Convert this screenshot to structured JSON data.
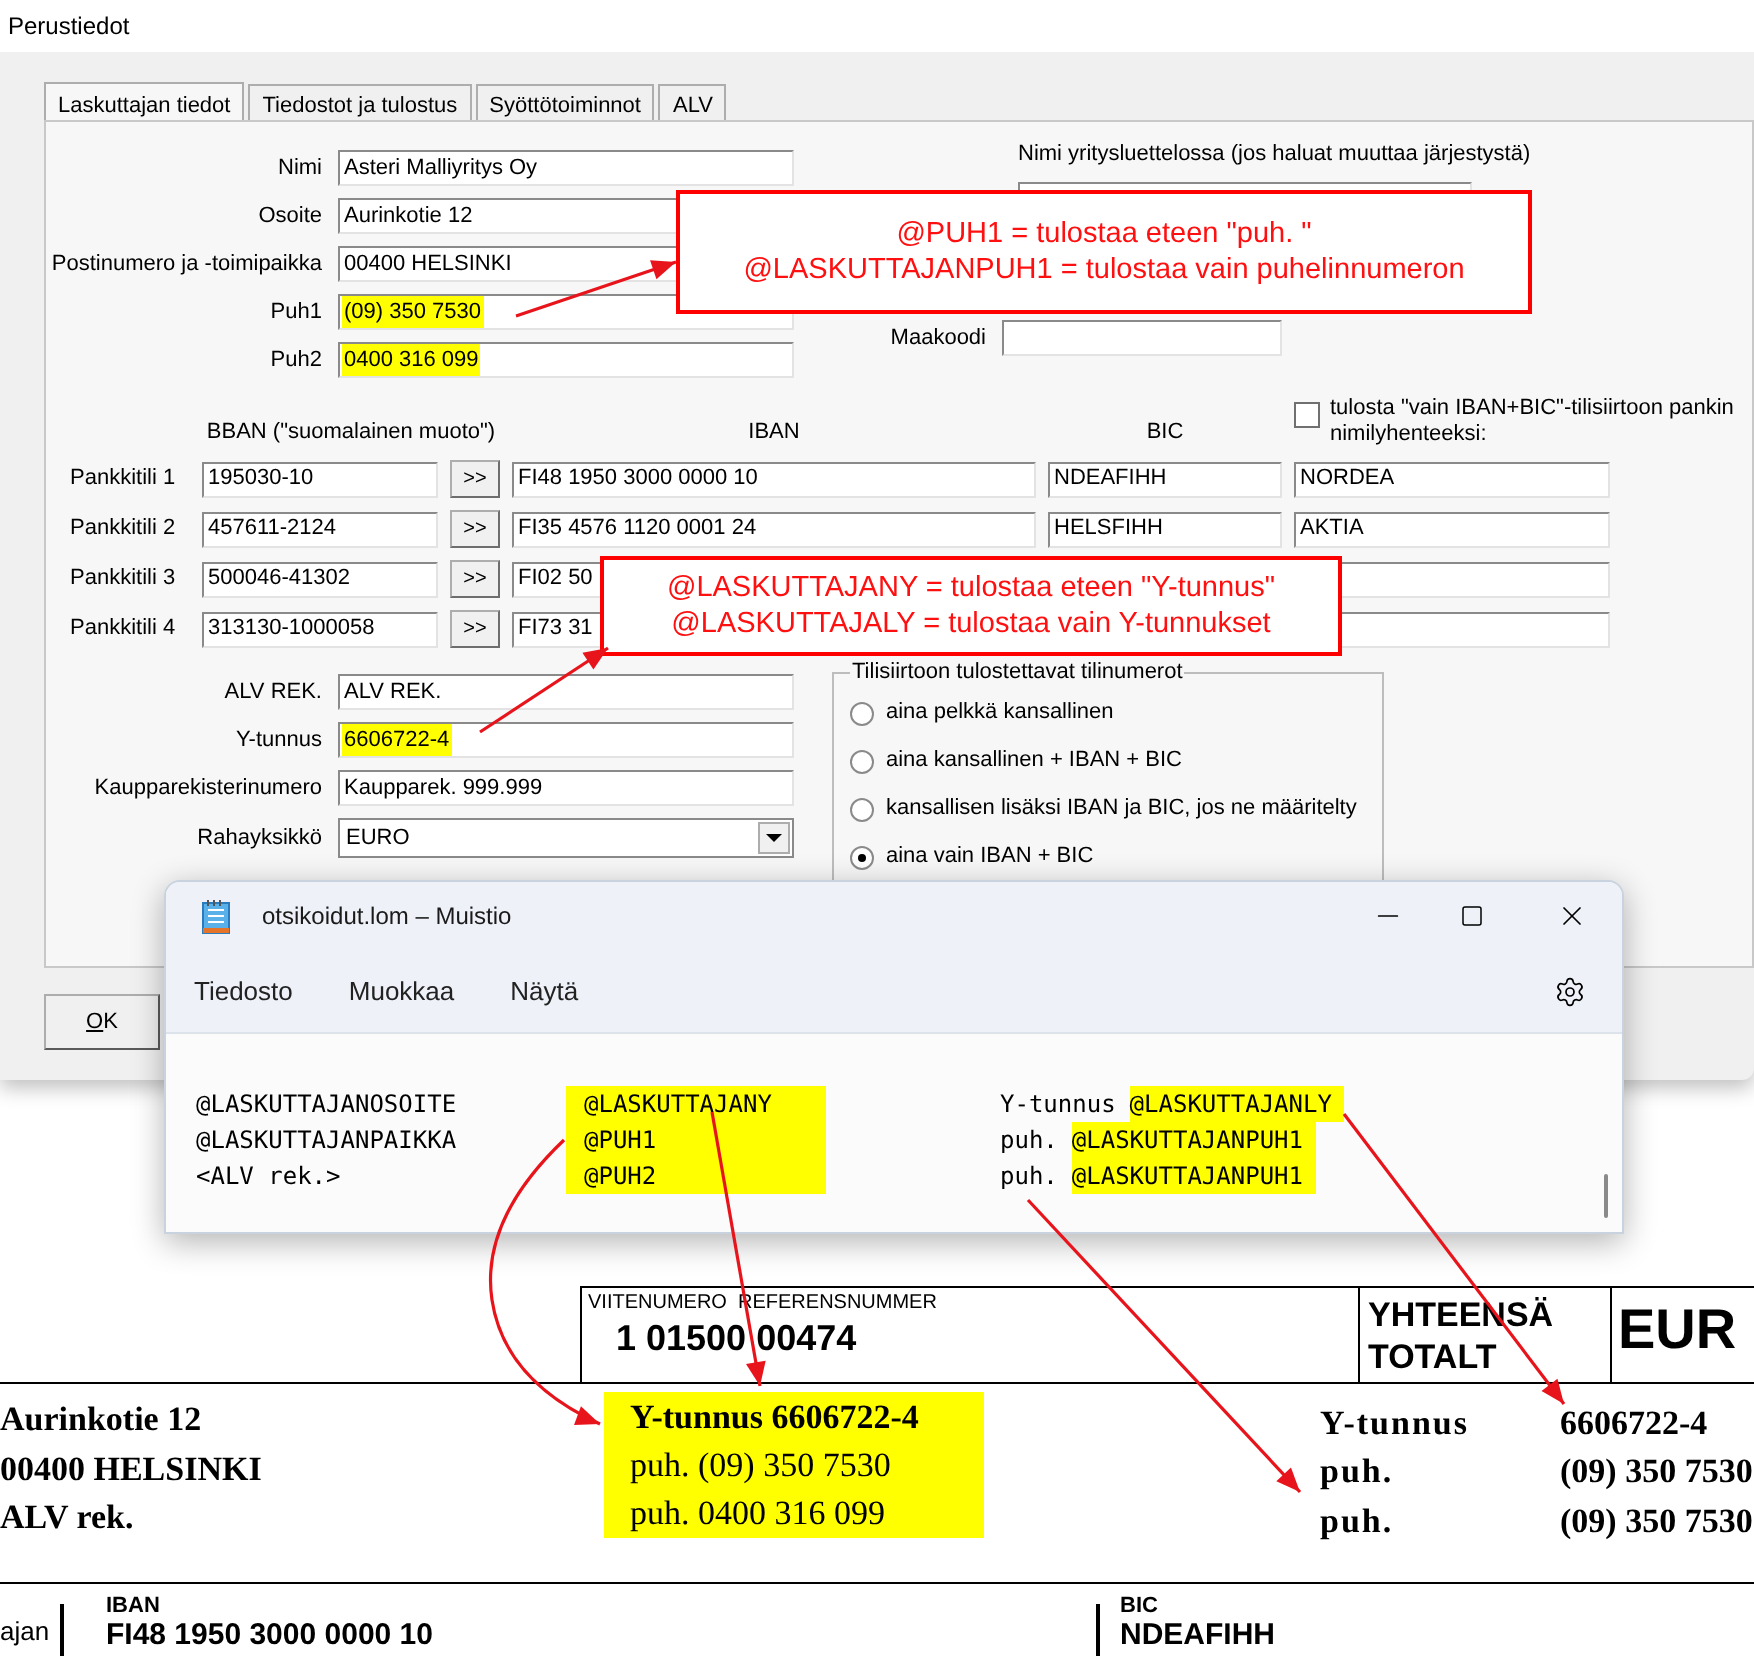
{
  "dialog": {
    "title": "Perustiedot",
    "tabs": [
      {
        "label": "Laskuttajan tiedot",
        "selected": true
      },
      {
        "label": "Tiedostot ja tulostus",
        "selected": false
      },
      {
        "label": "Syöttötoiminnot",
        "selected": false
      },
      {
        "label": "ALV",
        "selected": false
      }
    ],
    "top_fields": [
      {
        "label": "Nimi",
        "value": "Asteri Malliyritys Oy",
        "highlighted": false
      },
      {
        "label": "Osoite",
        "value": "Aurinkotie 12",
        "highlighted": false
      },
      {
        "label": "Postinumero ja -toimipaikka",
        "value": "00400 HELSINKI",
        "highlighted": false
      },
      {
        "label": "Puh1",
        "value": "(09) 350 7530",
        "highlighted": true
      },
      {
        "label": "Puh2",
        "value": "0400 316 099",
        "highlighted": true
      }
    ],
    "company_list_name": {
      "label": "Nimi yritysluettelossa (jos haluat muuttaa järjestystä)"
    },
    "country_code": {
      "label": "Maakoodi"
    },
    "bank": {
      "bban_header": "BBAN (\"suomalainen muoto\")",
      "iban_header": "IBAN",
      "bic_header": "BIC",
      "name_checkbox": {
        "label": "tulosta \"vain IBAN+BIC\"-tilisiirtoon pankin nimilyhenteeksi:",
        "checked": false
      },
      "accounts": [
        {
          "label": "Pankkitili 1",
          "bban": "195030-10",
          "button": ">>",
          "iban": "FI48 1950 3000 0000 10",
          "bic": "NDEAFIHH",
          "bank_name": "NORDEA"
        },
        {
          "label": "Pankkitili 2",
          "bban": "457611-2124",
          "button": ">>",
          "iban": "FI35 4576 1120 0001 24",
          "bic": "HELSFIHH",
          "bank_name": "AKTIA"
        },
        {
          "label": "Pankkitili 3",
          "bban": "500046-41302",
          "button": ">>",
          "iban": "FI02 50"
        },
        {
          "label": "Pankkitili 4",
          "bban": "313130-1000058",
          "button": ">>",
          "iban": "FI73 31"
        }
      ]
    },
    "lower_fields": [
      {
        "label": "ALV REK.",
        "value": "ALV REK.",
        "highlighted": false
      },
      {
        "label": "Y-tunnus",
        "value": "6606722-4",
        "highlighted": true
      },
      {
        "label": "Kaupparekisterinumero",
        "value": "Kaupparek. 999.999",
        "highlighted": false
      }
    ],
    "currency": {
      "label": "Rahayksikkö",
      "value": "EURO"
    },
    "account_print": {
      "title": "Tilisiirtoon tulostettavat tilinumerot",
      "options": [
        {
          "label": "aina pelkkä kansallinen",
          "selected": false
        },
        {
          "label": "aina kansallinen + IBAN + BIC",
          "selected": false
        },
        {
          "label": "kansallisen lisäksi IBAN ja BIC, jos ne määritelty",
          "selected": false
        },
        {
          "label": "aina vain IBAN + BIC",
          "selected": true
        }
      ]
    },
    "buttons": [
      "OK"
    ]
  },
  "callouts": [
    {
      "lines": [
        "@PUH1 = tulostaa eteen \"puh. \"",
        "@LASKUTTAJANPUH1 = tulostaa vain puhelinnumeron"
      ]
    },
    {
      "lines": [
        "@LASKUTTAJANY = tulostaa eteen \"Y-tunnus\"",
        "@LASKUTTAJALY = tulostaa vain Y-tunnukset"
      ]
    }
  ],
  "notepad": {
    "title": "otsikoidut.lom – Muistio",
    "menu": [
      "Tiedosto",
      "Muokkaa",
      "Näytä"
    ],
    "lines": [
      {
        "column_1": "@LASKUTTAJANOSOITE",
        "column_2": "@LASKUTTAJANY",
        "column_3_prefix": "Y-tunnus",
        "column_3_tag": "@LASKUTTAJANLY"
      },
      {
        "column_1": "@LASKUTTAJANPAIKKA",
        "column_2": "@PUH1",
        "column_3_prefix": "puh.",
        "column_3_tag": "@LASKUTTAJANPUH1"
      },
      {
        "column_1": "<ALV rek.>",
        "column_2": "@PUH2",
        "column_3_prefix": "puh.",
        "column_3_tag": "@LASKUTTAJANPUH1"
      }
    ]
  },
  "invoice": {
    "reference": {
      "label": "VIITENUMERO  REFERENSNUMMER",
      "value": "1 01500 00474"
    },
    "total_label": [
      "YHTEENSÄ",
      "TOTALT"
    ],
    "currency": "EUR",
    "address_lines": [
      "Aurinkotie 12",
      "00400 HELSINKI",
      "ALV rek."
    ],
    "highlighted_block": [
      {
        "text": "Y-tunnus 6606722-4",
        "bold": true
      },
      {
        "text": "puh. (09) 350 7530",
        "bold": false
      },
      {
        "text": "puh. 0400 316 099",
        "bold": false
      }
    ],
    "right_block": [
      {
        "label": "Y-tunnus",
        "value": "6606722-4"
      },
      {
        "label": "puh.",
        "value": "(09) 350 7530"
      },
      {
        "label": "puh.",
        "value": "(09) 350 7530"
      }
    ],
    "bank_row": {
      "column_1": "ajan",
      "iban_label": "IBAN",
      "iban": "FI48 1950 3000 0000 10",
      "bic_label": "BIC",
      "bic": "NDEAFIHH"
    }
  }
}
